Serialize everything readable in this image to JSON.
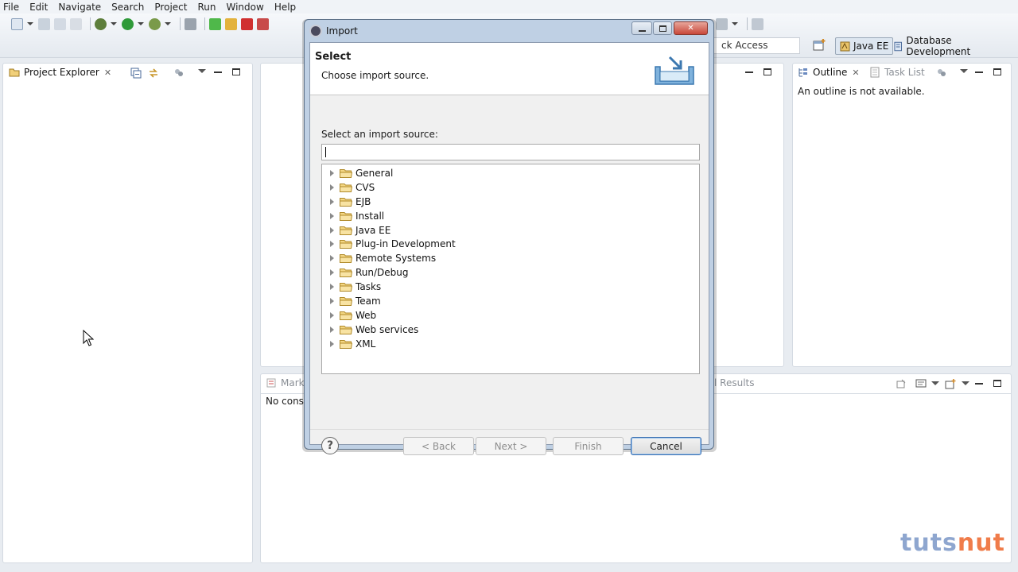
{
  "menu": [
    "File",
    "Edit",
    "Navigate",
    "Search",
    "Project",
    "Run",
    "Window",
    "Help"
  ],
  "toolbar": {
    "quick_access_text": "ck Access",
    "perspectives": [
      {
        "label": "Java EE",
        "active": true
      },
      {
        "label": "Database Development",
        "active": false
      }
    ]
  },
  "left_panel": {
    "tab_label": "Project Explorer"
  },
  "right_panel": {
    "tabs": [
      {
        "label": "Outline",
        "active": true
      },
      {
        "label": "Task List",
        "active": false
      }
    ],
    "message": "An outline is not available."
  },
  "bottom_panel": {
    "tab_visible": "Marke",
    "tab_right_visible": "l Results",
    "content_visible": "No consol"
  },
  "dialog": {
    "window_title": "Import",
    "header_title": "Select",
    "header_subtitle": "Choose import source.",
    "source_label": "Select an import source:",
    "filter_value": "",
    "tree": [
      "General",
      "CVS",
      "EJB",
      "Install",
      "Java EE",
      "Plug-in Development",
      "Remote Systems",
      "Run/Debug",
      "Tasks",
      "Team",
      "Web",
      "Web services",
      "XML"
    ],
    "buttons": {
      "help": "?",
      "back": "< Back",
      "next": "Next >",
      "finish": "Finish",
      "cancel": "Cancel"
    }
  },
  "watermark": {
    "part1": "tuts",
    "part2": "nut"
  },
  "colors": {
    "accent_blue": "#3a6fb0",
    "watermark_blue": "#8ea6cf",
    "watermark_orange": "#f07c4a"
  }
}
